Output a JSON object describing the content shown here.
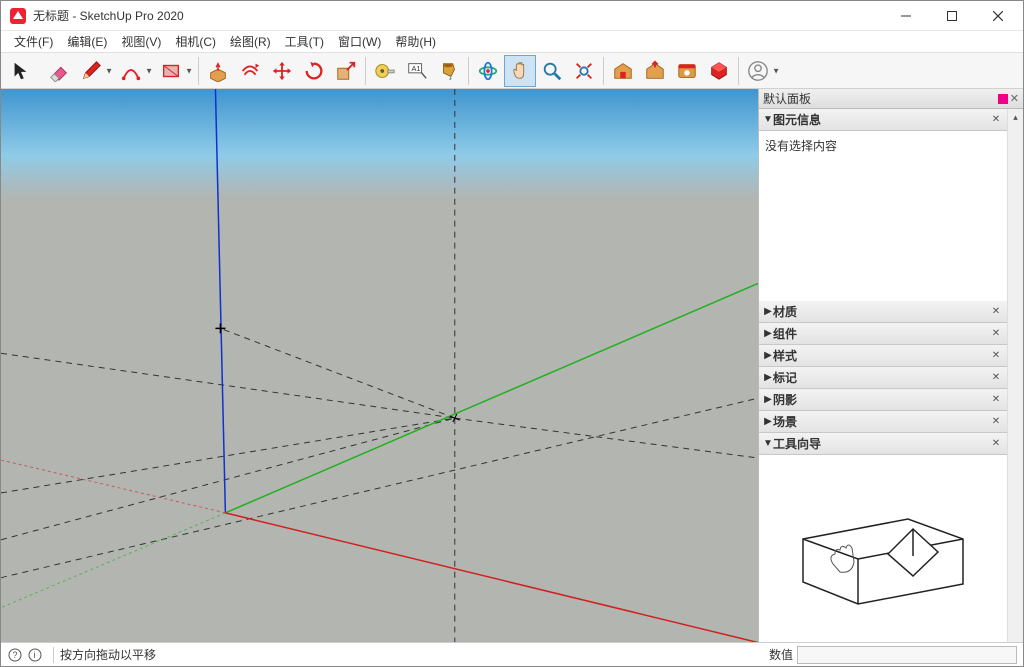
{
  "window": {
    "title": "无标题 - SketchUp Pro 2020"
  },
  "menu": {
    "file": "文件(F)",
    "edit": "编辑(E)",
    "view": "视图(V)",
    "camera": "相机(C)",
    "draw": "绘图(R)",
    "tools": "工具(T)",
    "window": "窗口(W)",
    "help": "帮助(H)"
  },
  "panel": {
    "header": "默认面板",
    "entity_info": "图元信息",
    "no_selection": "没有选择内容",
    "materials": "材质",
    "components": "组件",
    "styles": "样式",
    "tags": "标记",
    "shadows": "阴影",
    "scenes": "场景",
    "instructor": "工具向导"
  },
  "status": {
    "hint": "按方向拖动以平移",
    "value_label": "数值"
  },
  "toolbar_icons": {
    "select": "select",
    "eraser": "eraser",
    "pencil": "pencil",
    "arc": "arc",
    "rect": "rect",
    "pushpull": "pushpull",
    "offset": "offset",
    "move": "move",
    "rotate": "rotate",
    "scale": "scale",
    "tape": "tape",
    "text": "text",
    "paint": "paint",
    "orbit": "orbit",
    "pan": "pan",
    "zoom": "zoom",
    "zoom_extents": "zoom-extents",
    "warehouse": "warehouse",
    "warehouse2": "warehouse2",
    "ext_warehouse": "ext-warehouse",
    "ruby": "ruby",
    "user": "user"
  }
}
